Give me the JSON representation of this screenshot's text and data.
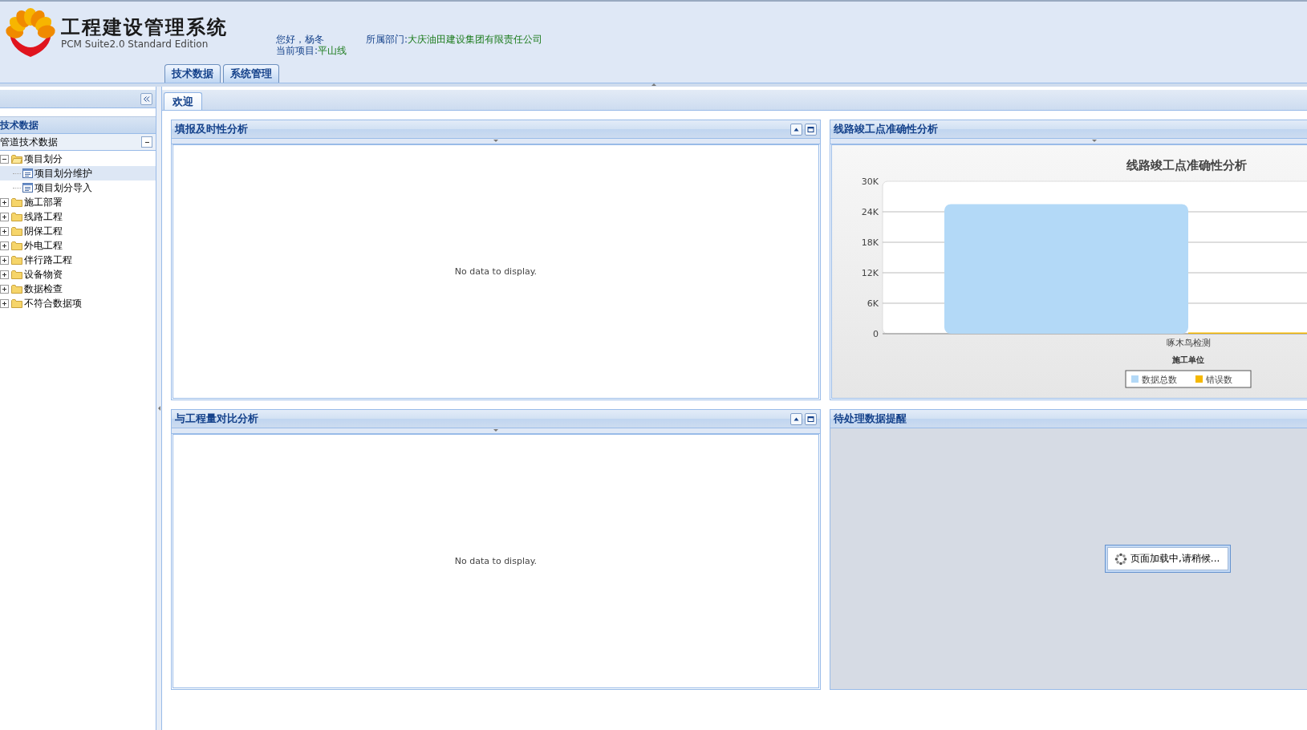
{
  "header": {
    "title": "工程建设管理系统",
    "subtitle": "PCM Suite2.0 Standard Edition",
    "greeting": "您好，杨冬",
    "project_label": "当前项目:",
    "project": "平山线",
    "dept_label": "所属部门:",
    "dept": "大庆油田建设集团有限责任公司"
  },
  "nav_tabs": [
    {
      "label": "技术数据"
    },
    {
      "label": "系统管理"
    }
  ],
  "sidebar": {
    "title": "技术数据",
    "section": {
      "label": "管道技术数据",
      "expanded": true
    },
    "tree": [
      {
        "label": "项目划分",
        "expanded": true,
        "children": [
          {
            "label": "项目划分维护",
            "selected": true
          },
          {
            "label": "项目划分导入",
            "selected": false
          }
        ]
      },
      {
        "label": "施工部署",
        "expanded": false
      },
      {
        "label": "线路工程",
        "expanded": false
      },
      {
        "label": "阴保工程",
        "expanded": false
      },
      {
        "label": "外电工程",
        "expanded": false
      },
      {
        "label": "伴行路工程",
        "expanded": false
      },
      {
        "label": "设备物资",
        "expanded": false
      },
      {
        "label": "数据检查",
        "expanded": false
      },
      {
        "label": "不符合数据项",
        "expanded": false
      }
    ]
  },
  "content_tabs": [
    {
      "label": "欢迎",
      "selected": true
    }
  ],
  "panels": [
    {
      "kind": "empty",
      "title": "填报及时性分析",
      "tools": true,
      "message": "No data to display."
    },
    {
      "kind": "chart",
      "title": "线路竣工点准确性分析",
      "chart_data": {
        "type": "bar",
        "title": "线路竣工点准确性分析",
        "xlabel": "施工单位",
        "categories": [
          "啄木鸟检测"
        ],
        "series": [
          {
            "name": "数据总数",
            "color": "#b3d9f7",
            "values": [
              25500
            ]
          },
          {
            "name": "错误数",
            "color": "#f5b800",
            "values": [
              0
            ]
          }
        ],
        "grid": true,
        "legend": true,
        "ylim": [
          0,
          30000
        ],
        "yticks": [
          {
            "value": 0,
            "label": "0"
          },
          {
            "value": 6000,
            "label": "6K"
          },
          {
            "value": 12000,
            "label": "12K"
          },
          {
            "value": 18000,
            "label": "18K"
          },
          {
            "value": 24000,
            "label": "24K"
          },
          {
            "value": 30000,
            "label": "30K"
          }
        ]
      }
    },
    {
      "kind": "empty",
      "title": "与工程量对比分析",
      "tools": true,
      "message": "No data to display."
    },
    {
      "kind": "loading",
      "title": "待处理数据提醒",
      "message": "页面加载中,请稍候..."
    }
  ]
}
